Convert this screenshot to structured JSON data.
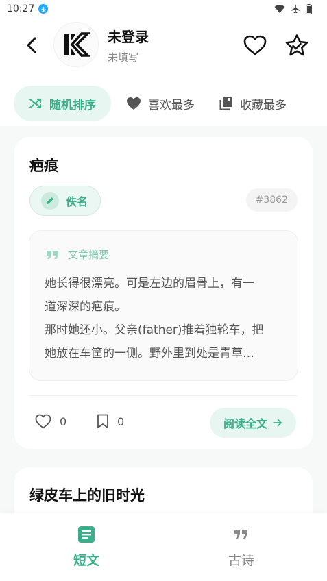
{
  "status_bar": {
    "time": "10:27",
    "icons": [
      "download-icon",
      "wifi-icon",
      "airplane-icon",
      "battery-icon"
    ]
  },
  "header": {
    "user_name": "未登录",
    "user_sub": "未填写",
    "avatar_icon": "k-logo",
    "back_icon": "chevron-left-icon",
    "right_icons": [
      "heart-icon",
      "star-badge-icon"
    ]
  },
  "sort_tabs": [
    {
      "label": "随机排序",
      "icon": "shuffle-icon",
      "active": true
    },
    {
      "label": "喜欢最多",
      "icon": "heart-icon",
      "active": false
    },
    {
      "label": "收藏最多",
      "icon": "library-icon",
      "active": false
    }
  ],
  "card": {
    "title": "疤痕",
    "author": "佚名",
    "id": "#3862",
    "summary_label": "文章摘要",
    "summary_lines": [
      "她长得很漂亮。可是左边的眉骨上，有一",
      "道深深的疤痕。",
      "那时她还小。父亲(father)推着独轮车，把",
      "她放在车筐的一侧。野外里到处是青草…"
    ],
    "likes": "0",
    "bookmarks": "0",
    "read_label": "阅读全文"
  },
  "card2": {
    "title": "绿皮车上的旧时光"
  },
  "bottom_nav": [
    {
      "label": "短文",
      "icon": "article-icon",
      "active": true
    },
    {
      "label": "古诗",
      "icon": "quote-icon",
      "active": false
    }
  ],
  "colors": {
    "accent": "#3aaf8a",
    "accent_light": "#e7f6f1",
    "background": "#f7f8f8"
  }
}
